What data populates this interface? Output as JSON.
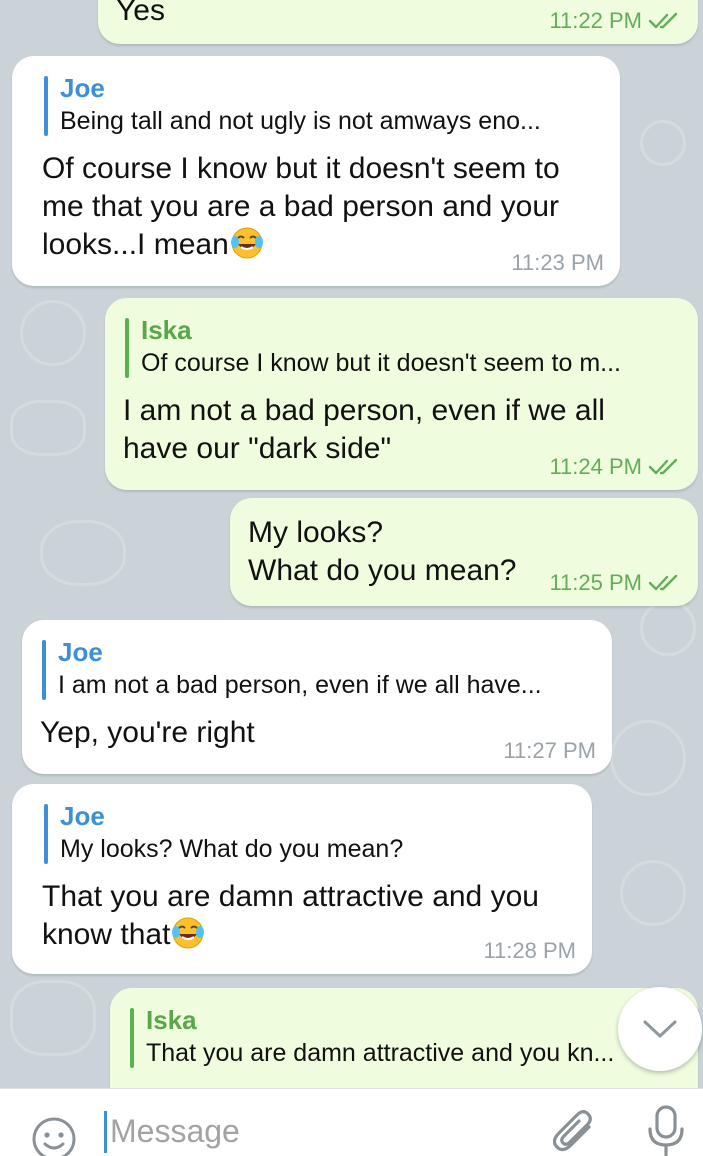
{
  "colors": {
    "incoming_bubble": "#ffffff",
    "outgoing_bubble": "#effdde",
    "incoming_accent": "#3d8fd6",
    "outgoing_accent": "#59b24e",
    "wallpaper": "#c9d3d8"
  },
  "messages": [
    {
      "text": "Yes",
      "time": "11:22 PM",
      "status": "read"
    },
    {
      "reply_name": "Joe",
      "reply_text": "Being tall and not ugly is not amways eno...",
      "text": "Of course I know but it doesn't seem to me that you are a bad person and your looks...I mean",
      "emoji": "face-with-tears-of-joy",
      "time": "11:23 PM"
    },
    {
      "reply_name": "Iska",
      "reply_text": "Of course I know but it doesn't seem to m...",
      "text": "I am not a bad person, even if we all have our \"dark side\"",
      "time": "11:24 PM",
      "status": "read"
    },
    {
      "line1": "My looks?",
      "line2": "What do you mean?",
      "time": "11:25 PM",
      "status": "read"
    },
    {
      "reply_name": "Joe",
      "reply_text": "I am not a bad person, even if we all have...",
      "text": "Yep, you're right",
      "time": "11:27 PM"
    },
    {
      "reply_name": "Joe",
      "reply_text": "My looks? What do you mean?",
      "text": "That you are damn attractive and you know that",
      "emoji": "face-with-tears-of-joy",
      "time": "11:28 PM"
    },
    {
      "reply_name": "Iska",
      "reply_text": "That you are damn attractive and you kn..."
    }
  ],
  "input": {
    "placeholder": "Message",
    "value": ""
  },
  "icons": {
    "emoji_button": "smile-icon",
    "attach_button": "paperclip-icon",
    "mic_button": "microphone-icon",
    "scroll_down": "chevron-down-icon",
    "read_status": "double-check-icon"
  }
}
